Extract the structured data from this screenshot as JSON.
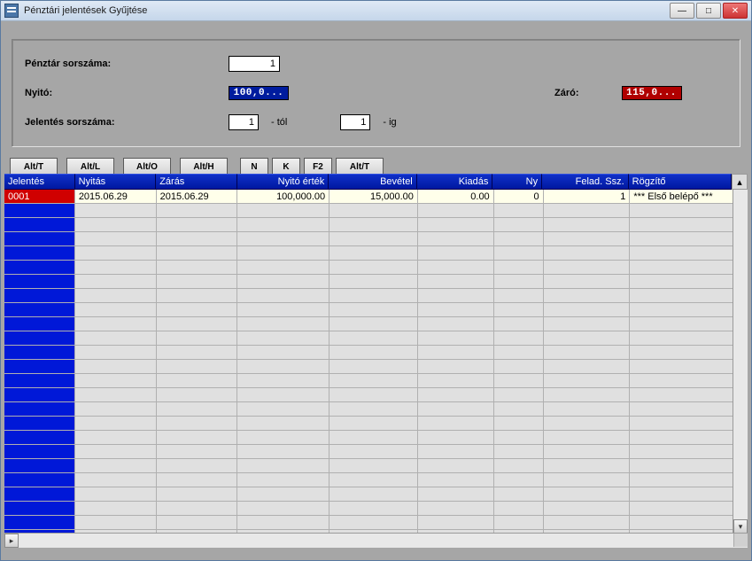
{
  "window": {
    "title": "Pénztári jelentések Gyűjtése"
  },
  "form": {
    "penztar_label": "Pénztár sorszáma:",
    "penztar_value": "1",
    "nyito_label": "Nyitó:",
    "nyito_value": "100,0...",
    "zaro_label": "Záró:",
    "zaro_value": "115,0...",
    "jelentes_label": "Jelentés sorszáma:",
    "jelentes_from": "1",
    "tol": "- tól",
    "jelentes_to": "1",
    "ig": "- ig"
  },
  "toolbar": {
    "b1": "Alt/T",
    "b2": "Alt/L",
    "b3": "Alt/O",
    "b4": "Alt/H",
    "b5": "N",
    "b6": "K",
    "b7": "F2",
    "b8": "Alt/T"
  },
  "grid": {
    "headers": [
      "Jelentés",
      "Nyitás",
      "Zárás",
      "Nyitó érték",
      "Bevétel",
      "Kiadás",
      "Ny",
      "Felad. Ssz.",
      "Rögzítő"
    ],
    "row": {
      "code": "0001",
      "open": "2015.06.29",
      "close": "2015.06.29",
      "openval": "100,000.00",
      "income": "15,000.00",
      "expense": "0.00",
      "ny": "0",
      "felad": "1",
      "rogzito": "*** Első  belépő ***"
    }
  }
}
